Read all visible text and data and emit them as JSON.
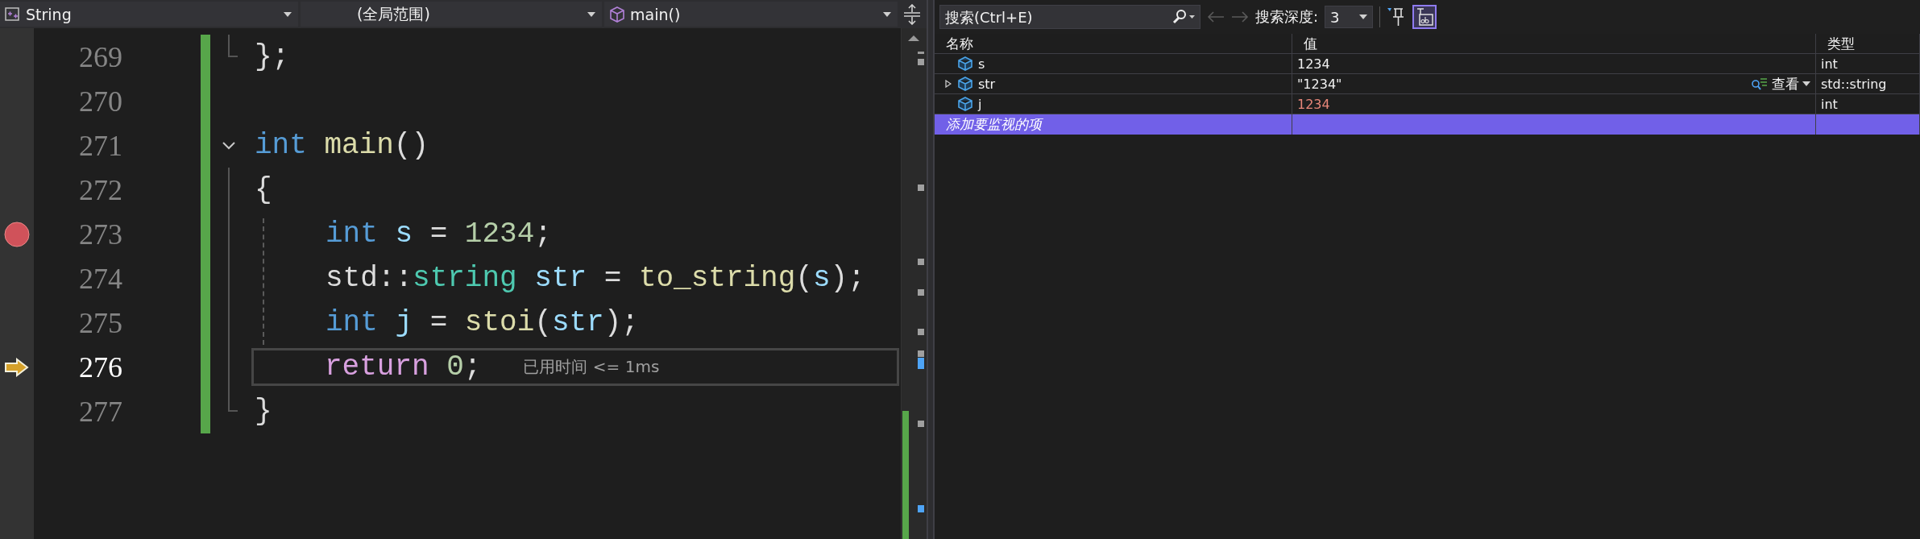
{
  "editor": {
    "nav": [
      "String",
      "(全局范围)",
      "main()"
    ],
    "lines": [
      {
        "number": "269",
        "kind": "end",
        "tokens": [
          {
            "text": "};",
            "kind": "plain"
          }
        ]
      },
      {
        "number": "270",
        "kind": "plain"
      },
      {
        "number": "271",
        "kind": "start",
        "expanded": true,
        "tokens": [
          {
            "text": "int",
            "kind": "keyword"
          },
          {
            "text": " main",
            "kind": "function"
          },
          {
            "text": "()",
            "kind": "plain"
          }
        ]
      },
      {
        "number": "272",
        "kind": "body",
        "tokens": [
          {
            "text": "{",
            "kind": "plain"
          }
        ],
        "children": [
          {
            "number": "273",
            "kind": "body",
            "breakpoint": true,
            "tokens": [
              {
                "text": "int",
                "kind": "keyword"
              },
              {
                "text": " s",
                "kind": "variable"
              },
              {
                "text": " = ",
                "kind": "plain"
              },
              {
                "text": "1234",
                "kind": "number"
              },
              {
                "text": ";",
                "kind": "plain"
              }
            ]
          },
          {
            "number": "274",
            "kind": "body",
            "tokens": [
              {
                "text": "std::",
                "kind": "plain"
              },
              {
                "text": "string",
                "kind": "type"
              },
              {
                "text": " str",
                "kind": "variable"
              },
              {
                "text": " = ",
                "kind": "plain"
              },
              {
                "text": "to_string",
                "kind": "function"
              },
              {
                "text": "(",
                "kind": "plain"
              },
              {
                "text": "s",
                "kind": "variable"
              },
              {
                "text": ");",
                "kind": "plain"
              }
            ]
          },
          {
            "number": "275",
            "kind": "body",
            "tokens": [
              {
                "text": "int",
                "kind": "keyword"
              },
              {
                "text": " j",
                "kind": "variable"
              },
              {
                "text": " = ",
                "kind": "plain"
              },
              {
                "text": "stoi",
                "kind": "function"
              },
              {
                "text": "(",
                "kind": "plain"
              },
              {
                "text": "str",
                "kind": "variable"
              },
              {
                "text": ");",
                "kind": "plain"
              }
            ]
          },
          {
            "number": "276",
            "kind": "body",
            "current": true,
            "hint": "已用时间 <= 1ms",
            "tokens": [
              {
                "text": "return",
                "kind": "control"
              },
              {
                "text": " 0",
                "kind": "number"
              },
              {
                "text": ";",
                "kind": "plain"
              }
            ]
          }
        ]
      },
      {
        "number": "277",
        "kind": "end",
        "tokens": [
          {
            "text": "}",
            "kind": "plain"
          }
        ]
      }
    ]
  },
  "watch": {
    "search": {
      "placeholder": "搜索(Ctrl+E)"
    },
    "depth_label": "搜索深度:",
    "depth": "3",
    "format_toggle": {
      "on": true
    },
    "columns": [
      "名称",
      "值",
      "类型"
    ],
    "rows": [
      {
        "name": "s",
        "value": "1234",
        "type": "int",
        "changed": false
      },
      {
        "name": "str",
        "value": "\"1234\"",
        "type": "std::string",
        "expandable": true,
        "changed": false,
        "visualizer": "查看"
      },
      {
        "name": "j",
        "value": "1234",
        "type": "int",
        "changed": true
      }
    ],
    "add_row": {
      "text": "添加要监视的项",
      "selected": true
    }
  }
}
